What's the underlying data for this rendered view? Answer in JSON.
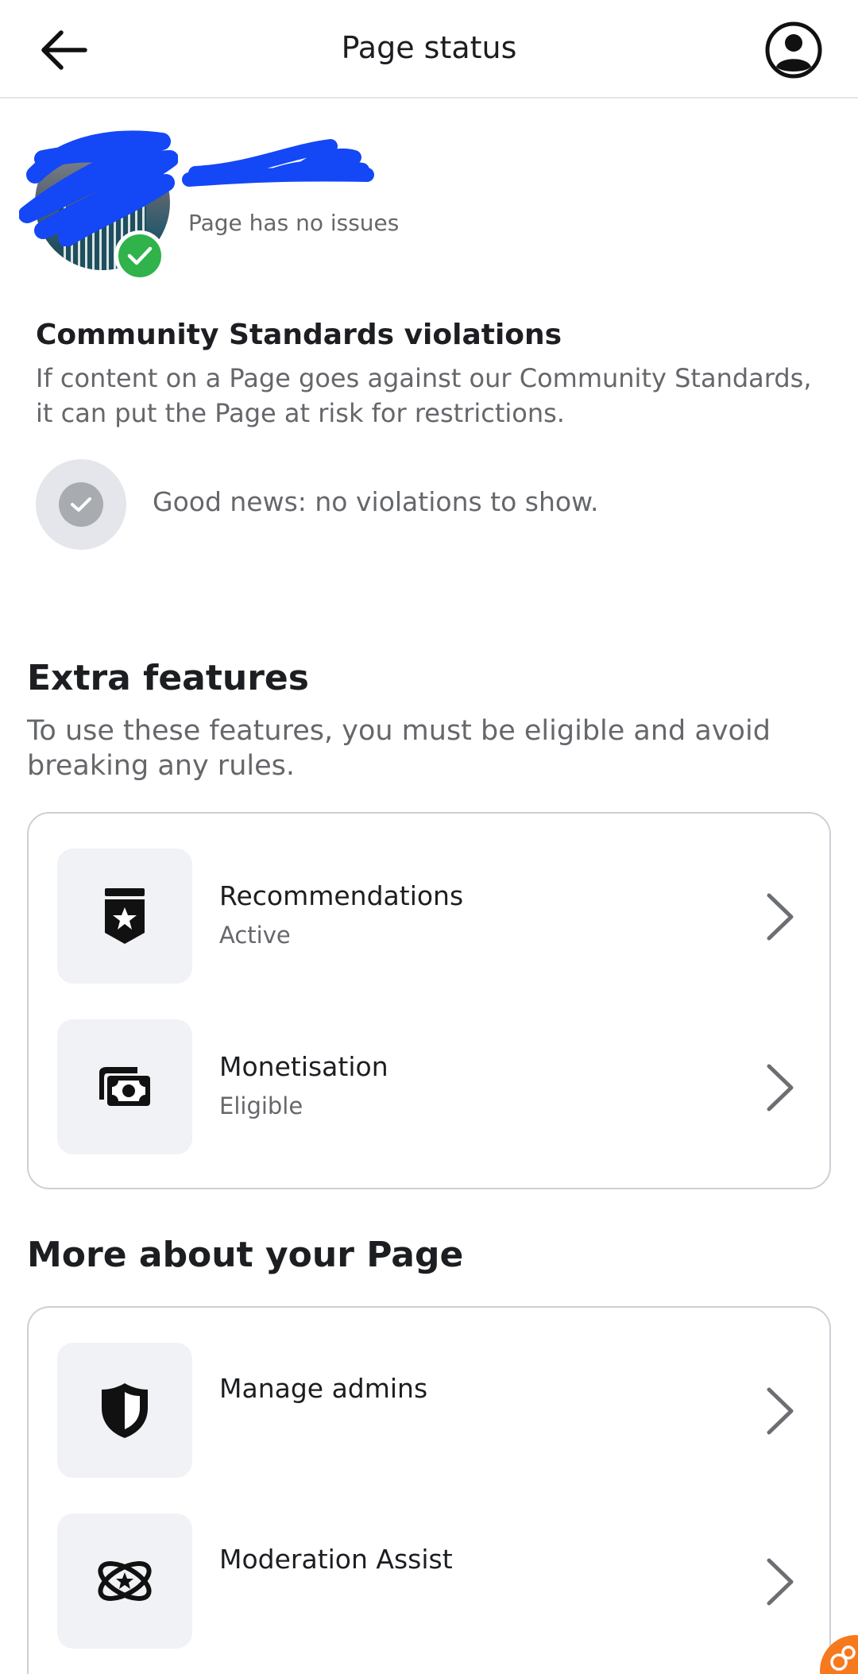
{
  "header": {
    "title": "Page status",
    "back_icon": "arrow-left-icon",
    "account_icon": "user-circle-icon"
  },
  "profile": {
    "status": "Page has no issues",
    "badge_color": "#2fb34a"
  },
  "violations": {
    "title": "Community Standards violations",
    "description": "If content on a Page goes against our Community Standards, it can put the Page at risk for restrictions.",
    "empty_message": "Good news: no violations to show."
  },
  "extra_features": {
    "title": "Extra features",
    "description": "To use these features, you must be eligible and avoid breaking any rules.",
    "items": [
      {
        "label": "Recommendations",
        "status": "Active",
        "icon": "star-badge-icon"
      },
      {
        "label": "Monetisation",
        "status": "Eligible",
        "icon": "money-icon"
      }
    ]
  },
  "more_about": {
    "title": "More about your Page",
    "items": [
      {
        "label": "Manage admins",
        "icon": "shield-icon"
      },
      {
        "label": "Moderation Assist",
        "icon": "atom-star-icon"
      }
    ]
  },
  "colors": {
    "accent_orange": "#f7791e",
    "redaction_blue": "#1447f5"
  }
}
